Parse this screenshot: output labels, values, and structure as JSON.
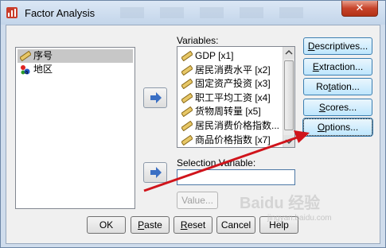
{
  "window": {
    "title": "Factor Analysis",
    "close_glyph": "✕"
  },
  "source_list": {
    "items": [
      {
        "label": "序号",
        "icon": "ruler-icon",
        "selected": true
      },
      {
        "label": "地区",
        "icon": "nominal-ball-icon",
        "selected": false
      }
    ]
  },
  "variables": {
    "label": "Variables:",
    "items": [
      "GDP [x1]",
      "居民消费水平 [x2]",
      "固定资产投资 [x3]",
      "职工平均工资 [x4]",
      "货物周转量 [x5]",
      "居民消费价格指数...",
      "商品价格指数 [x7]"
    ]
  },
  "selection_variable": {
    "label": "Selection Variable:",
    "value": ""
  },
  "value_button": "Value...",
  "side_buttons": [
    {
      "pre": "",
      "u": "D",
      "post": "escriptives..."
    },
    {
      "pre": "",
      "u": "E",
      "post": "xtraction..."
    },
    {
      "pre": "Ro",
      "u": "t",
      "post": "ation..."
    },
    {
      "pre": "",
      "u": "S",
      "post": "cores..."
    },
    {
      "pre": "",
      "u": "O",
      "post": "ptions..."
    }
  ],
  "bottom_buttons": [
    {
      "pre": "OK",
      "u": "",
      "post": ""
    },
    {
      "pre": "",
      "u": "P",
      "post": "aste"
    },
    {
      "pre": "",
      "u": "R",
      "post": "eset"
    },
    {
      "pre": "Cancel",
      "u": "",
      "post": ""
    },
    {
      "pre": "Help",
      "u": "",
      "post": ""
    }
  ],
  "watermark": {
    "main": "Baidu 经验",
    "sub": "jingyan.baidu.com"
  },
  "colors": {
    "annotation_arrow": "#d0141b",
    "arrow_button": "#3a6fc4"
  }
}
